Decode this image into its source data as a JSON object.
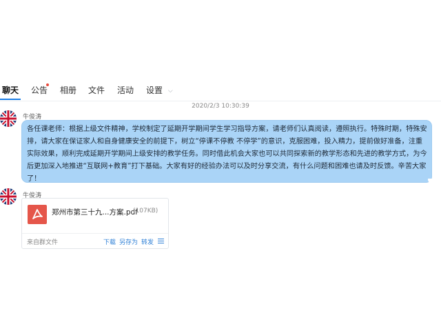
{
  "tabs": [
    {
      "label": "聊天",
      "active": true
    },
    {
      "label": "公告",
      "has_dot": true
    },
    {
      "label": "相册"
    },
    {
      "label": "文件"
    },
    {
      "label": "活动"
    },
    {
      "label": "设置",
      "icon": "chevron-down-icon"
    }
  ],
  "chat": {
    "timestamp": "2020/2/3 10:30:39",
    "messages": [
      {
        "sender": "牛俊涛",
        "text": "各任课老师：根据上级文件精神，学校制定了延期开学期间学生学习指导方案，请老师们认真阅读，遵照执行。特殊时期，特殊安排，请大家在保证家人和自身健康安全的前提下，树立“停课不停教 不停学”的意识，克服困难，投入精力，提前做好准备，注重实际效果，顺利完成延期开学期间上级安排的教学任务。同时借此机会大家也可以共同探索新的教学形态和先进的教学方式，为今后更加深入地推进“互联网+教育”打下基础。大家有好的经验办法可以及时分享交流，有什么问题和困难也请及时反馈。辛苦大家了！"
      },
      {
        "sender": "牛俊涛",
        "file": {
          "name": "郑州市第三十九...方案.pdf",
          "size": "(107KB)",
          "source": "来自群文件",
          "actions": [
            "下载",
            "另存为",
            "转发"
          ],
          "icon": "pdf-icon",
          "icon_color": "#e5564a"
        }
      }
    ]
  },
  "colors": {
    "accent": "#1a7ee6",
    "bubble": "#aad4f7",
    "link": "#2d7fd6"
  }
}
